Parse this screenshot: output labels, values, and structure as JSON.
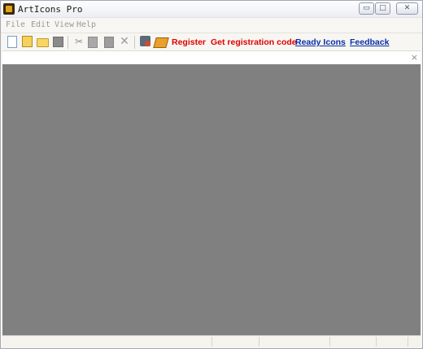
{
  "window": {
    "title": "ArtIcons Pro",
    "min_glyph": "▭",
    "max_glyph": "□",
    "close_glyph": "✕"
  },
  "menu": [
    "File",
    "Edit",
    "View",
    "Help"
  ],
  "toolbar": {
    "icons": [
      "new-icon",
      "open-palette-icon",
      "open-folder-icon",
      "save-icon",
      "cut-icon",
      "copy-icon",
      "paste-icon",
      "delete-icon",
      "tools-icon",
      "book-icon"
    ],
    "links": {
      "register": "Register",
      "get_code": "Get registration code",
      "ready_icons": "Ready Icons",
      "feedback": "Feedback"
    },
    "cut_glyph": "✂",
    "delete_glyph": "✕"
  },
  "tabstrip": {
    "close_glyph": "×"
  },
  "colors": {
    "workspace": "#808080",
    "register_link": "#e00000",
    "nav_link": "#0a2fa8"
  }
}
